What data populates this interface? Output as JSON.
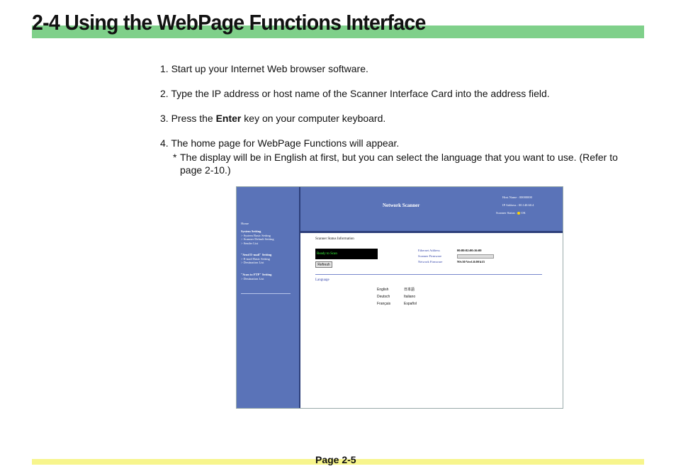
{
  "header": {
    "title": "2-4  Using the WebPage Functions Interface"
  },
  "steps": [
    {
      "text": "1. Start up your Internet Web browser software."
    },
    {
      "text": "2. Type the IP address or host name of the Scanner Interface Card into the address field."
    },
    {
      "pre": "3. Press the ",
      "bold": "Enter",
      "post": " key on your computer keyboard."
    },
    {
      "text": "4. The home page for WebPage Functions will appear."
    }
  ],
  "note": {
    "star": "*",
    "text": "The display will be in English at first, but you can select the language that you want to use. (Refer to page 2-10.)"
  },
  "screenshot": {
    "sidebar": {
      "home": "Home",
      "system_setting": "System Setting",
      "system_items": [
        "> System Basic Setting",
        "> Scanner Default Setting",
        "> Sender List"
      ],
      "send_email": "\"Send E-mail\" Setting",
      "send_email_items": [
        "> E-mail Basic Setting",
        "> Destination List"
      ],
      "scan_ftp": "\"Scan to FTP\" Setting",
      "scan_ftp_items": [
        "> Destination List"
      ]
    },
    "banner": {
      "title": "Network Scanner",
      "host_label": "Host Name :",
      "host_value": "00000000",
      "ip_label": "IP Address :",
      "ip_value": "00.140.60.4",
      "status_label": "Scanner Status :",
      "status_value": "OK"
    },
    "main": {
      "section_title": "Scanner Status Information",
      "status_text": "Ready to Scan",
      "refresh_label": "Refresh",
      "ethernet_label": "Ethernet Address",
      "ethernet_value": "00:80:92:00:16:00",
      "scanner_fw_label": "Scanner Firmware",
      "network_fw_label": "Network Firmware",
      "network_fw_value": "NS:30 Ver1.0.00 k15",
      "language_label": "Language",
      "languages": [
        "English",
        "Deutsch",
        "Français",
        "日本語",
        "Italiano",
        "Español"
      ]
    }
  },
  "footer": {
    "page": "Page 2-5"
  }
}
